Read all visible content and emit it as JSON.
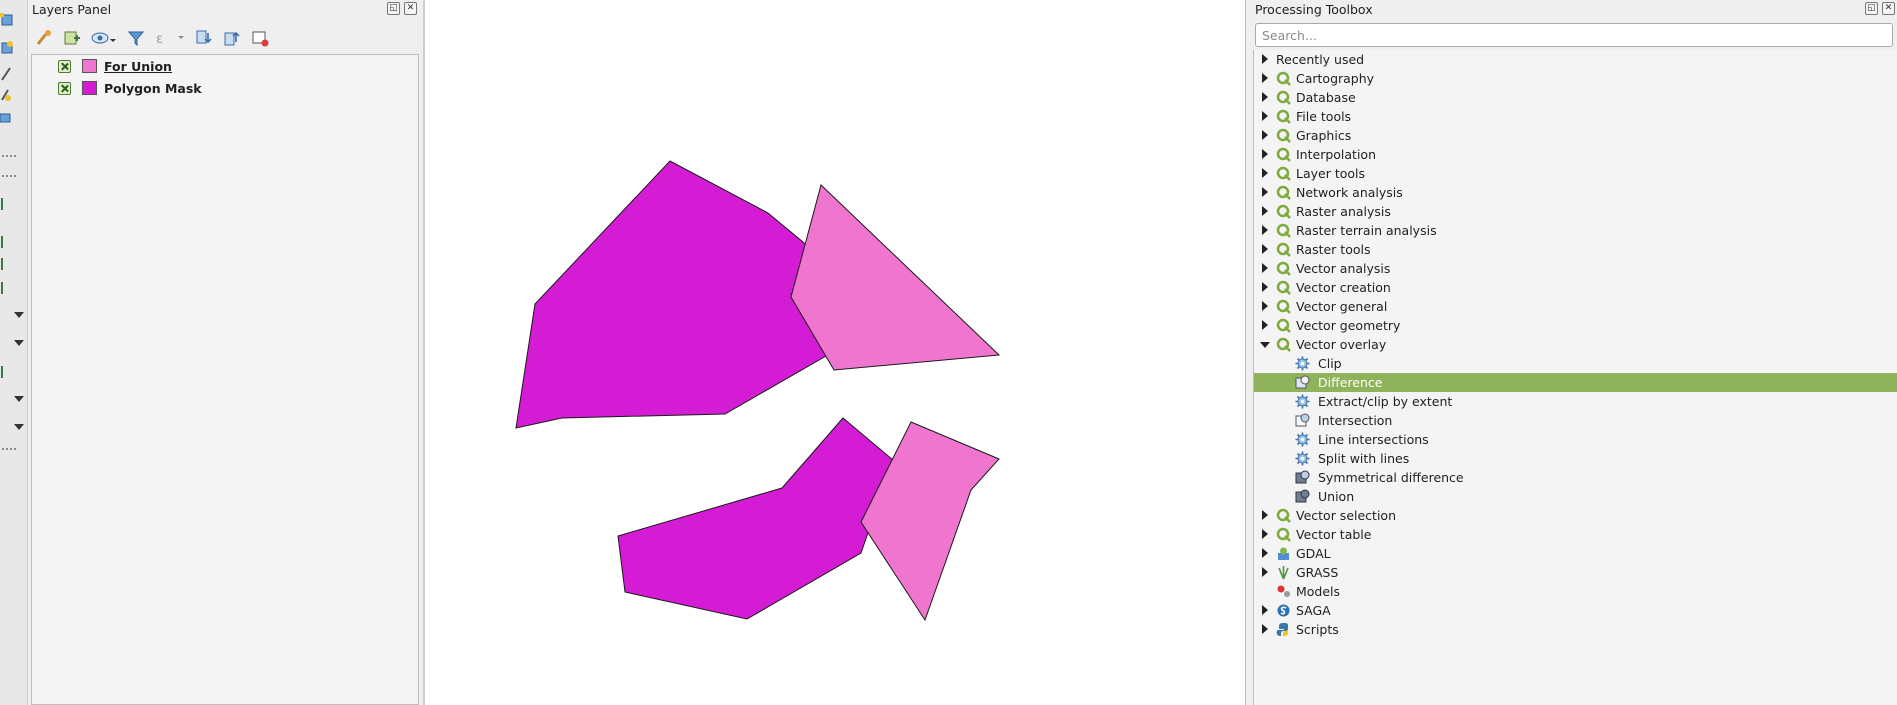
{
  "layers_panel": {
    "title": "Layers Panel",
    "layers": [
      {
        "name": "For Union",
        "checked": true,
        "color": "#f075cf",
        "active": true
      },
      {
        "name": "Polygon Mask",
        "checked": true,
        "color": "#d41cd4",
        "active": false
      }
    ]
  },
  "map": {
    "mask_color": "#d41cd4",
    "union_color": "#f075cf",
    "stroke_color": "#1a1a1a"
  },
  "toolbox": {
    "title": "Processing Toolbox",
    "search_placeholder": "Search...",
    "groups": {
      "recently_used": "Recently used",
      "cartography": "Cartography",
      "database": "Database",
      "file_tools": "File tools",
      "graphics": "Graphics",
      "interpolation": "Interpolation",
      "layer_tools": "Layer tools",
      "network_analysis": "Network analysis",
      "raster_analysis": "Raster analysis",
      "raster_terrain": "Raster terrain analysis",
      "raster_tools": "Raster tools",
      "vector_analysis": "Vector analysis",
      "vector_creation": "Vector creation",
      "vector_general": "Vector general",
      "vector_geometry": "Vector geometry",
      "vector_overlay": "Vector overlay",
      "vector_selection": "Vector selection",
      "vector_table": "Vector table",
      "gdal": "GDAL",
      "grass": "GRASS",
      "models": "Models",
      "saga": "SAGA",
      "scripts": "Scripts"
    },
    "overlay_items": {
      "clip": "Clip",
      "difference": "Difference",
      "extract_clip": "Extract/clip by extent",
      "intersection": "Intersection",
      "line_intersections": "Line intersections",
      "split_with_lines": "Split with lines",
      "symmetrical_difference": "Symmetrical difference",
      "union": "Union"
    },
    "selected_item": "Difference",
    "selection_color": "#8fb35a"
  }
}
